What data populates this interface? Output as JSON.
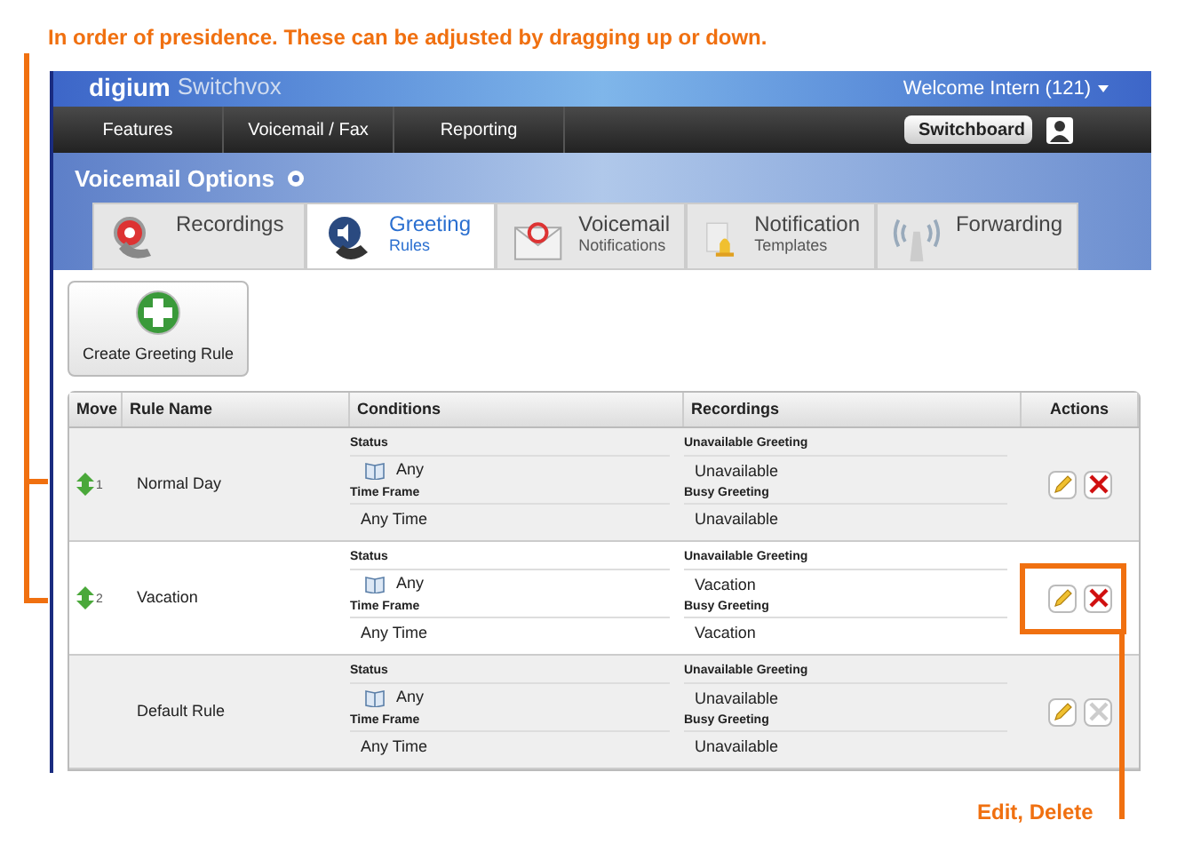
{
  "annotations": {
    "top_note": "In order of presidence. These can be adjusted by dragging up or down.",
    "actions_note": "Edit, Delete"
  },
  "header": {
    "logo": "digium",
    "product": "Switchvox",
    "welcome": "Welcome Intern (121)"
  },
  "nav": {
    "items": [
      "Features",
      "Voicemail / Fax",
      "Reporting"
    ],
    "switchboard": "Switchboard"
  },
  "page_title": "Voicemail Options",
  "tabs": [
    {
      "kind": "recordings",
      "label": "Recordings",
      "selected": false
    },
    {
      "kind": "greeting",
      "label": "Greeting",
      "sublabel": "Rules",
      "selected": true
    },
    {
      "kind": "voicemail",
      "label": "Voicemail",
      "sublabel": "Notifications",
      "selected": false
    },
    {
      "kind": "notification",
      "label": "Notification",
      "sublabel": "Templates",
      "selected": false
    },
    {
      "kind": "forwarding",
      "label": "Forwarding",
      "selected": false
    }
  ],
  "create_button": "Create Greeting Rule",
  "table": {
    "columns": [
      "Move",
      "Rule Name",
      "Conditions",
      "Recordings",
      "Actions"
    ],
    "rows": [
      {
        "order": "1",
        "name": "Normal Day",
        "status_label": "Status",
        "status": "Any",
        "time_label": "Time Frame",
        "time": "Any Time",
        "unavailable_label": "Unavailable Greeting",
        "unavailable": "Unavailable",
        "busy_label": "Busy Greeting",
        "busy": "Unavailable",
        "delete_disabled": false
      },
      {
        "order": "2",
        "name": "Vacation",
        "status_label": "Status",
        "status": "Any",
        "time_label": "Time Frame",
        "time": "Any Time",
        "unavailable_label": "Unavailable Greeting",
        "unavailable": "Vacation",
        "busy_label": "Busy Greeting",
        "busy": "Vacation",
        "delete_disabled": false
      },
      {
        "name": "Default Rule",
        "status_label": "Status",
        "status": "Any",
        "time_label": "Time Frame",
        "time": "Any Time",
        "unavailable_label": "Unavailable Greeting",
        "unavailable": "Unavailable",
        "busy_label": "Busy Greeting",
        "busy": "Unavailable",
        "delete_disabled": true
      }
    ]
  }
}
